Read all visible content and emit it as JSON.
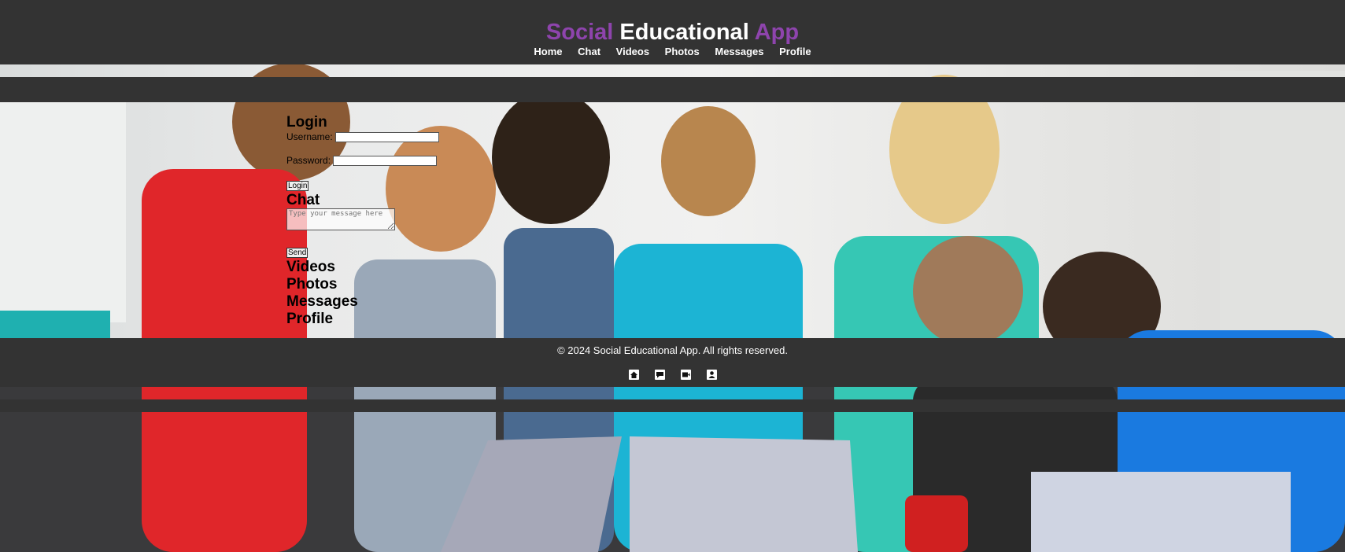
{
  "header": {
    "title_part1": "Social",
    "title_part2": "Educational",
    "title_part3": "App",
    "nav": {
      "home": "Home",
      "chat": "Chat",
      "videos": "Videos",
      "photos": "Photos",
      "messages": "Messages",
      "profile": "Profile"
    }
  },
  "login": {
    "heading": "Login",
    "username_label": "Username:",
    "password_label": "Password:",
    "button_label": "Login"
  },
  "chat": {
    "heading": "Chat",
    "placeholder": "Type your message here",
    "send_label": "Send"
  },
  "sections": {
    "videos": "Videos",
    "photos": "Photos",
    "messages": "Messages",
    "profile": "Profile"
  },
  "footer": {
    "copyright": "© 2024 Social Educational App. All rights reserved.",
    "icons": [
      "home-icon",
      "chat-icon",
      "video-icon",
      "profile-icon"
    ]
  },
  "colors": {
    "bar": "#333333",
    "accent": "#8e44ad",
    "text_light": "#ffffff"
  }
}
